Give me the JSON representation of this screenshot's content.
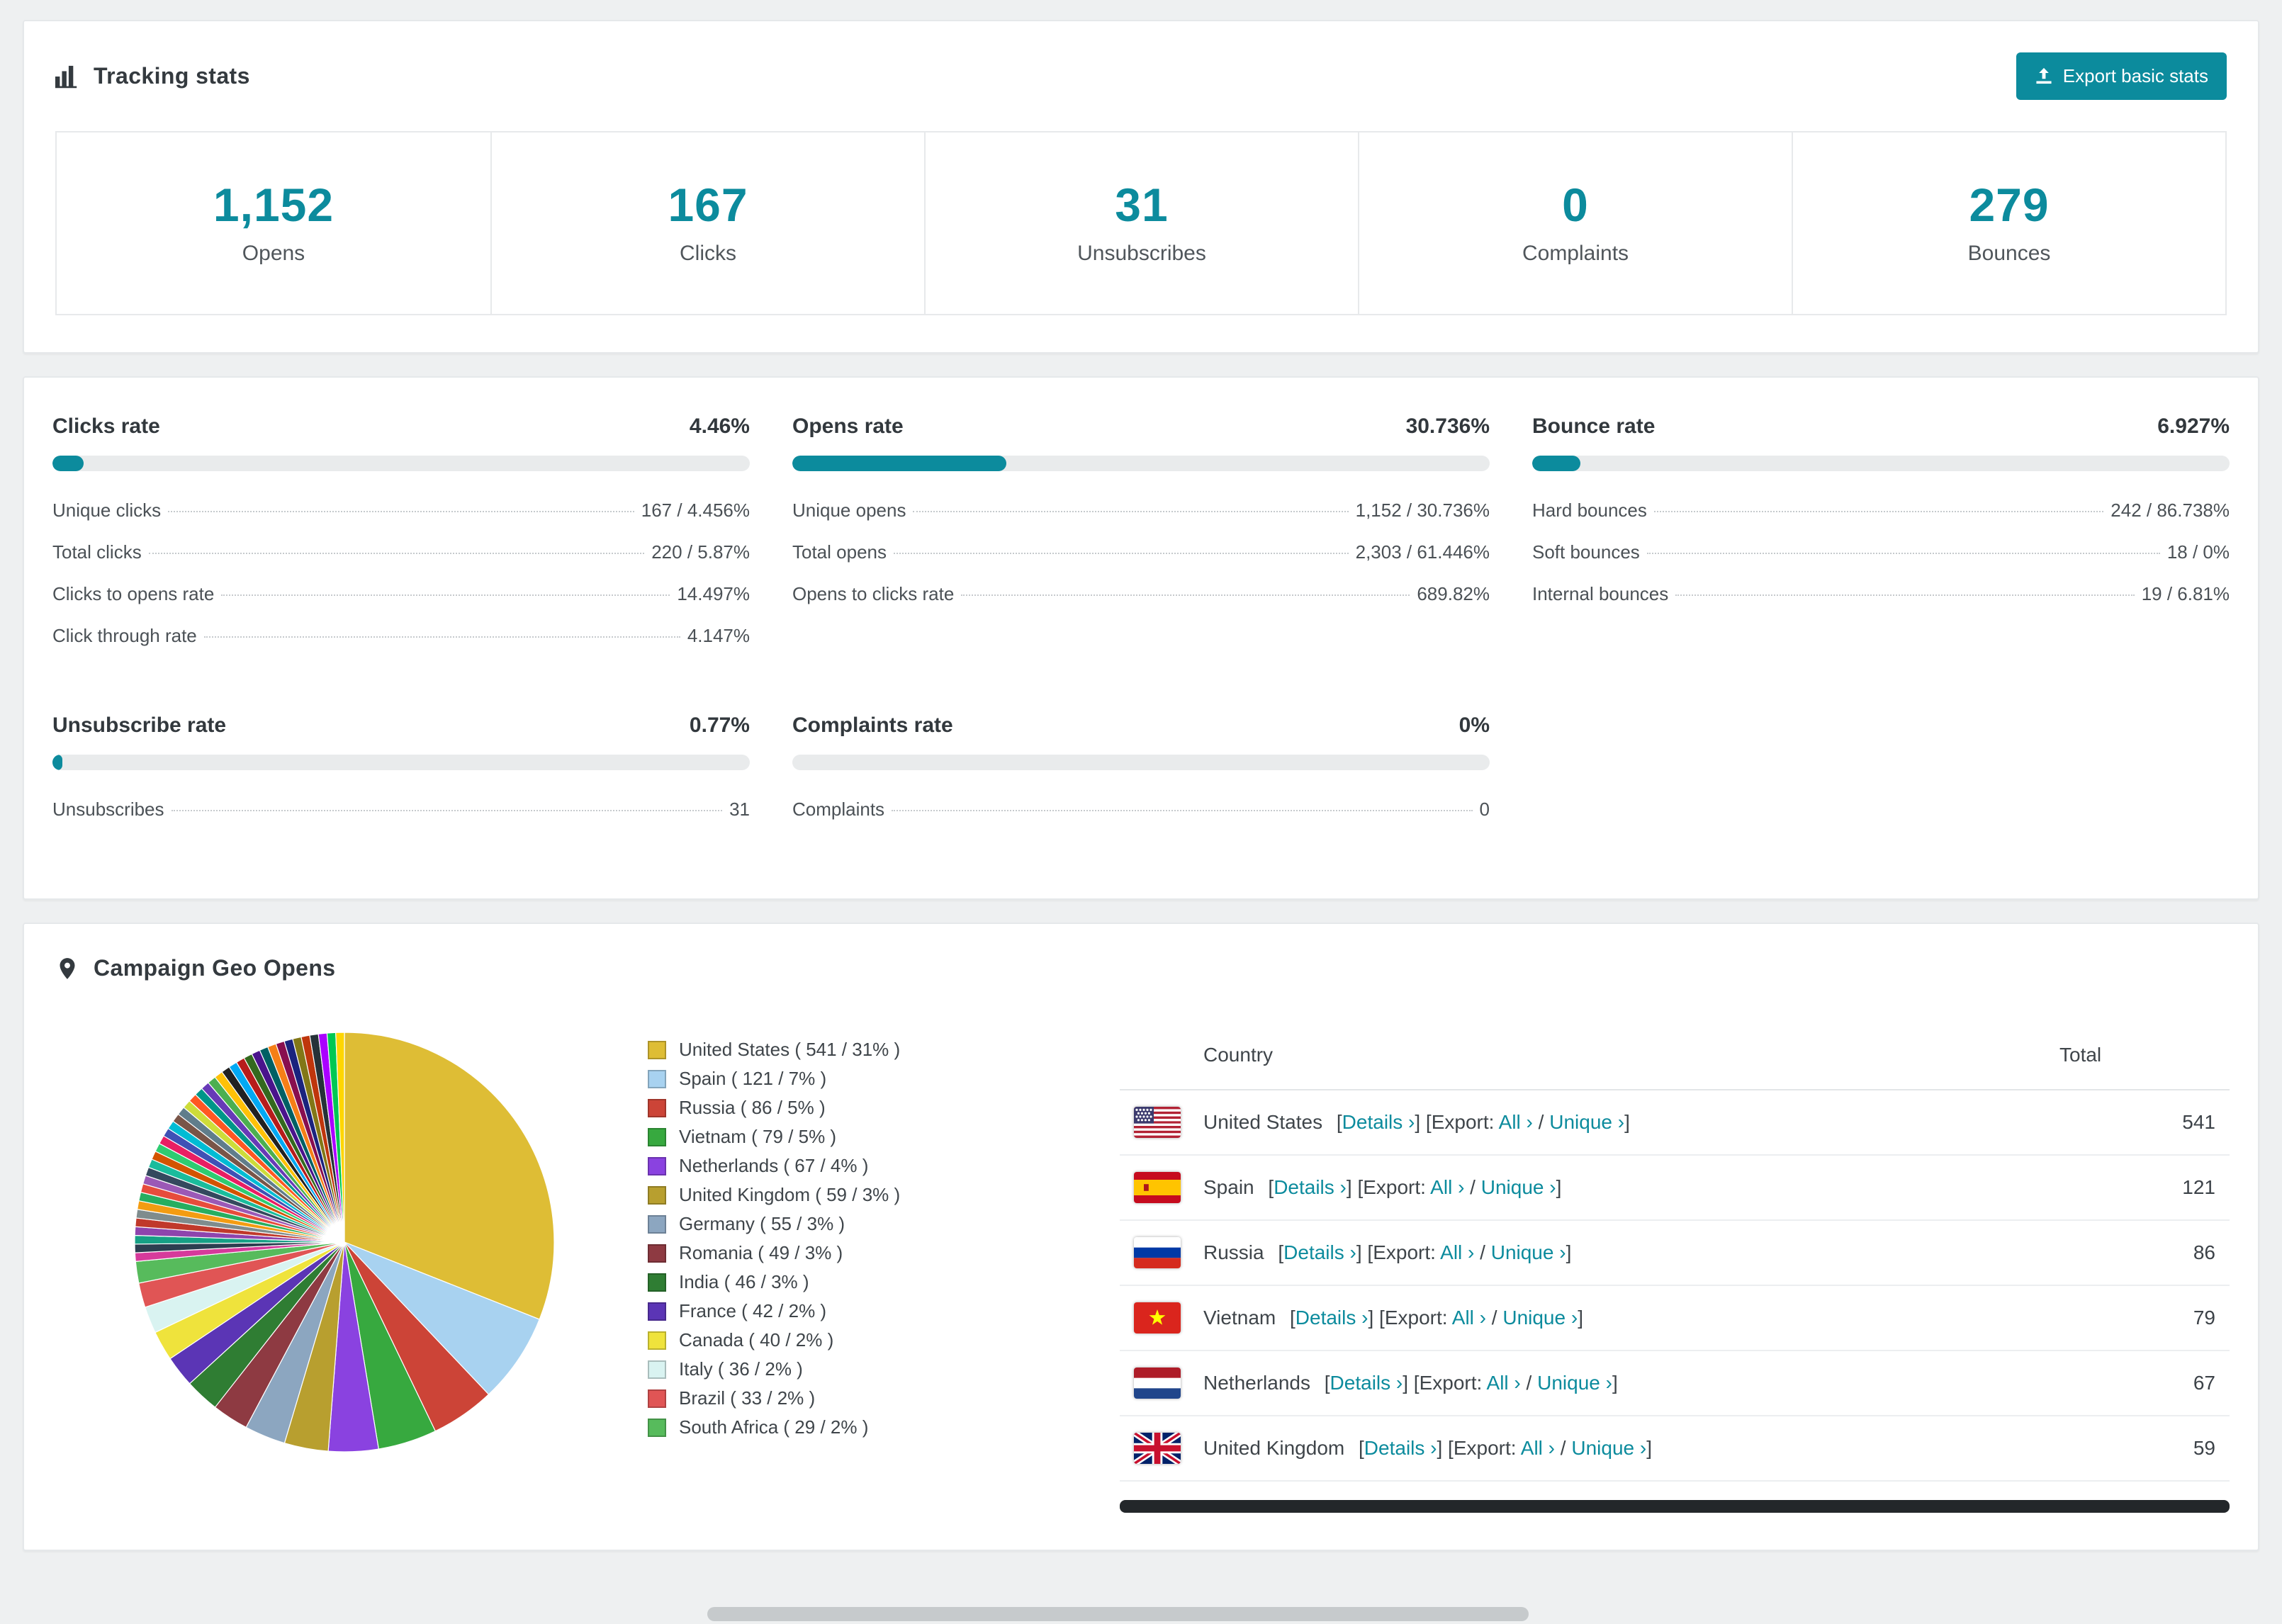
{
  "accent_color": "#0c8b9d",
  "icons": {
    "tracking": "bar-chart-icon",
    "export_button": "export-icon",
    "geo": "map-pin-icon"
  },
  "tracking": {
    "title": "Tracking stats",
    "export_button": "Export basic stats",
    "stats": [
      {
        "value": "1,152",
        "label": "Opens"
      },
      {
        "value": "167",
        "label": "Clicks"
      },
      {
        "value": "31",
        "label": "Unsubscribes"
      },
      {
        "value": "0",
        "label": "Complaints"
      },
      {
        "value": "279",
        "label": "Bounces"
      }
    ]
  },
  "rates": [
    {
      "title": "Clicks rate",
      "value": "4.46%",
      "pct": 4.46,
      "rows": [
        [
          "Unique clicks",
          "167 / 4.456%"
        ],
        [
          "Total clicks",
          "220 / 5.87%"
        ],
        [
          "Clicks to opens rate",
          "14.497%"
        ],
        [
          "Click through rate",
          "4.147%"
        ]
      ]
    },
    {
      "title": "Opens rate",
      "value": "30.736%",
      "pct": 30.736,
      "rows": [
        [
          "Unique opens",
          "1,152 / 30.736%"
        ],
        [
          "Total opens",
          "2,303 / 61.446%"
        ],
        [
          "Opens to clicks rate",
          "689.82%"
        ]
      ]
    },
    {
      "title": "Bounce rate",
      "value": "6.927%",
      "pct": 6.927,
      "rows": [
        [
          "Hard bounces",
          "242 / 86.738%"
        ],
        [
          "Soft bounces",
          "18 / 0%"
        ],
        [
          "Internal bounces",
          "19 / 6.81%"
        ]
      ]
    },
    {
      "title": "Unsubscribe rate",
      "value": "0.77%",
      "pct": 0.77,
      "rows": [
        [
          "Unsubscribes",
          "31"
        ]
      ]
    },
    {
      "title": "Complaints rate",
      "value": "0%",
      "pct": 0,
      "rows": [
        [
          "Complaints",
          "0"
        ]
      ]
    }
  ],
  "geo": {
    "title": "Campaign Geo Opens",
    "table": {
      "headers": [
        "Country",
        "Total"
      ],
      "link_labels": {
        "details": "Details ›",
        "export_prefix": "Export:",
        "all": "All ›",
        "unique": "Unique ›"
      },
      "rows": [
        {
          "country": "United States",
          "flag": "us",
          "total": "541"
        },
        {
          "country": "Spain",
          "flag": "es",
          "total": "121"
        },
        {
          "country": "Russia",
          "flag": "ru",
          "total": "86"
        },
        {
          "country": "Vietnam",
          "flag": "vn",
          "total": "79"
        },
        {
          "country": "Netherlands",
          "flag": "nl",
          "total": "67"
        },
        {
          "country": "United Kingdom",
          "flag": "gb",
          "total": "59"
        }
      ]
    }
  },
  "chart_data": {
    "type": "pie",
    "title": "Campaign Geo Opens",
    "legend_position": "right",
    "slices": [
      {
        "label": "United States",
        "count": 541,
        "percent": 31,
        "color": "#debd35"
      },
      {
        "label": "Spain",
        "count": 121,
        "percent": 7,
        "color": "#a8d2f0"
      },
      {
        "label": "Russia",
        "count": 86,
        "percent": 5,
        "color": "#cc4437"
      },
      {
        "label": "Vietnam",
        "count": 79,
        "percent": 5,
        "color": "#37a93f"
      },
      {
        "label": "Netherlands",
        "count": 67,
        "percent": 4,
        "color": "#8a42e0"
      },
      {
        "label": "United Kingdom",
        "count": 59,
        "percent": 3,
        "color": "#b89f2f"
      },
      {
        "label": "Germany",
        "count": 55,
        "percent": 3,
        "color": "#8ca6c0"
      },
      {
        "label": "Romania",
        "count": 49,
        "percent": 3,
        "color": "#8e3a42"
      },
      {
        "label": "India",
        "count": 46,
        "percent": 3,
        "color": "#2f7d33"
      },
      {
        "label": "France",
        "count": 42,
        "percent": 2,
        "color": "#5b35b5"
      },
      {
        "label": "Canada",
        "count": 40,
        "percent": 2,
        "color": "#efe33c"
      },
      {
        "label": "Italy",
        "count": 36,
        "percent": 2,
        "color": "#d9f3f1"
      },
      {
        "label": "Brazil",
        "count": 33,
        "percent": 2,
        "color": "#e05555"
      },
      {
        "label": "South Africa",
        "count": 29,
        "percent": 2,
        "color": "#57bb5c"
      }
    ],
    "others": {
      "count": 462,
      "colors": [
        "#d63a9b",
        "#2c3e50",
        "#16a085",
        "#8e44ad",
        "#c0392b",
        "#7f8c8d",
        "#f39c12",
        "#27ae60",
        "#e74c3c",
        "#9b59b6",
        "#34495e",
        "#1abc9c",
        "#d35400",
        "#2ecc71",
        "#e91e63",
        "#3f51b5",
        "#00bcd4",
        "#795548",
        "#607d8b",
        "#cddc39",
        "#ff5722",
        "#009688",
        "#673ab7",
        "#4caf50",
        "#ffc107",
        "#212121",
        "#03a9f4",
        "#b71c1c",
        "#33691e",
        "#4a148c",
        "#006064",
        "#f57f17",
        "#880e4f",
        "#1a237e",
        "#827717",
        "#bf360c",
        "#263238",
        "#aa00ff",
        "#00c853",
        "#ffd600"
      ]
    }
  }
}
